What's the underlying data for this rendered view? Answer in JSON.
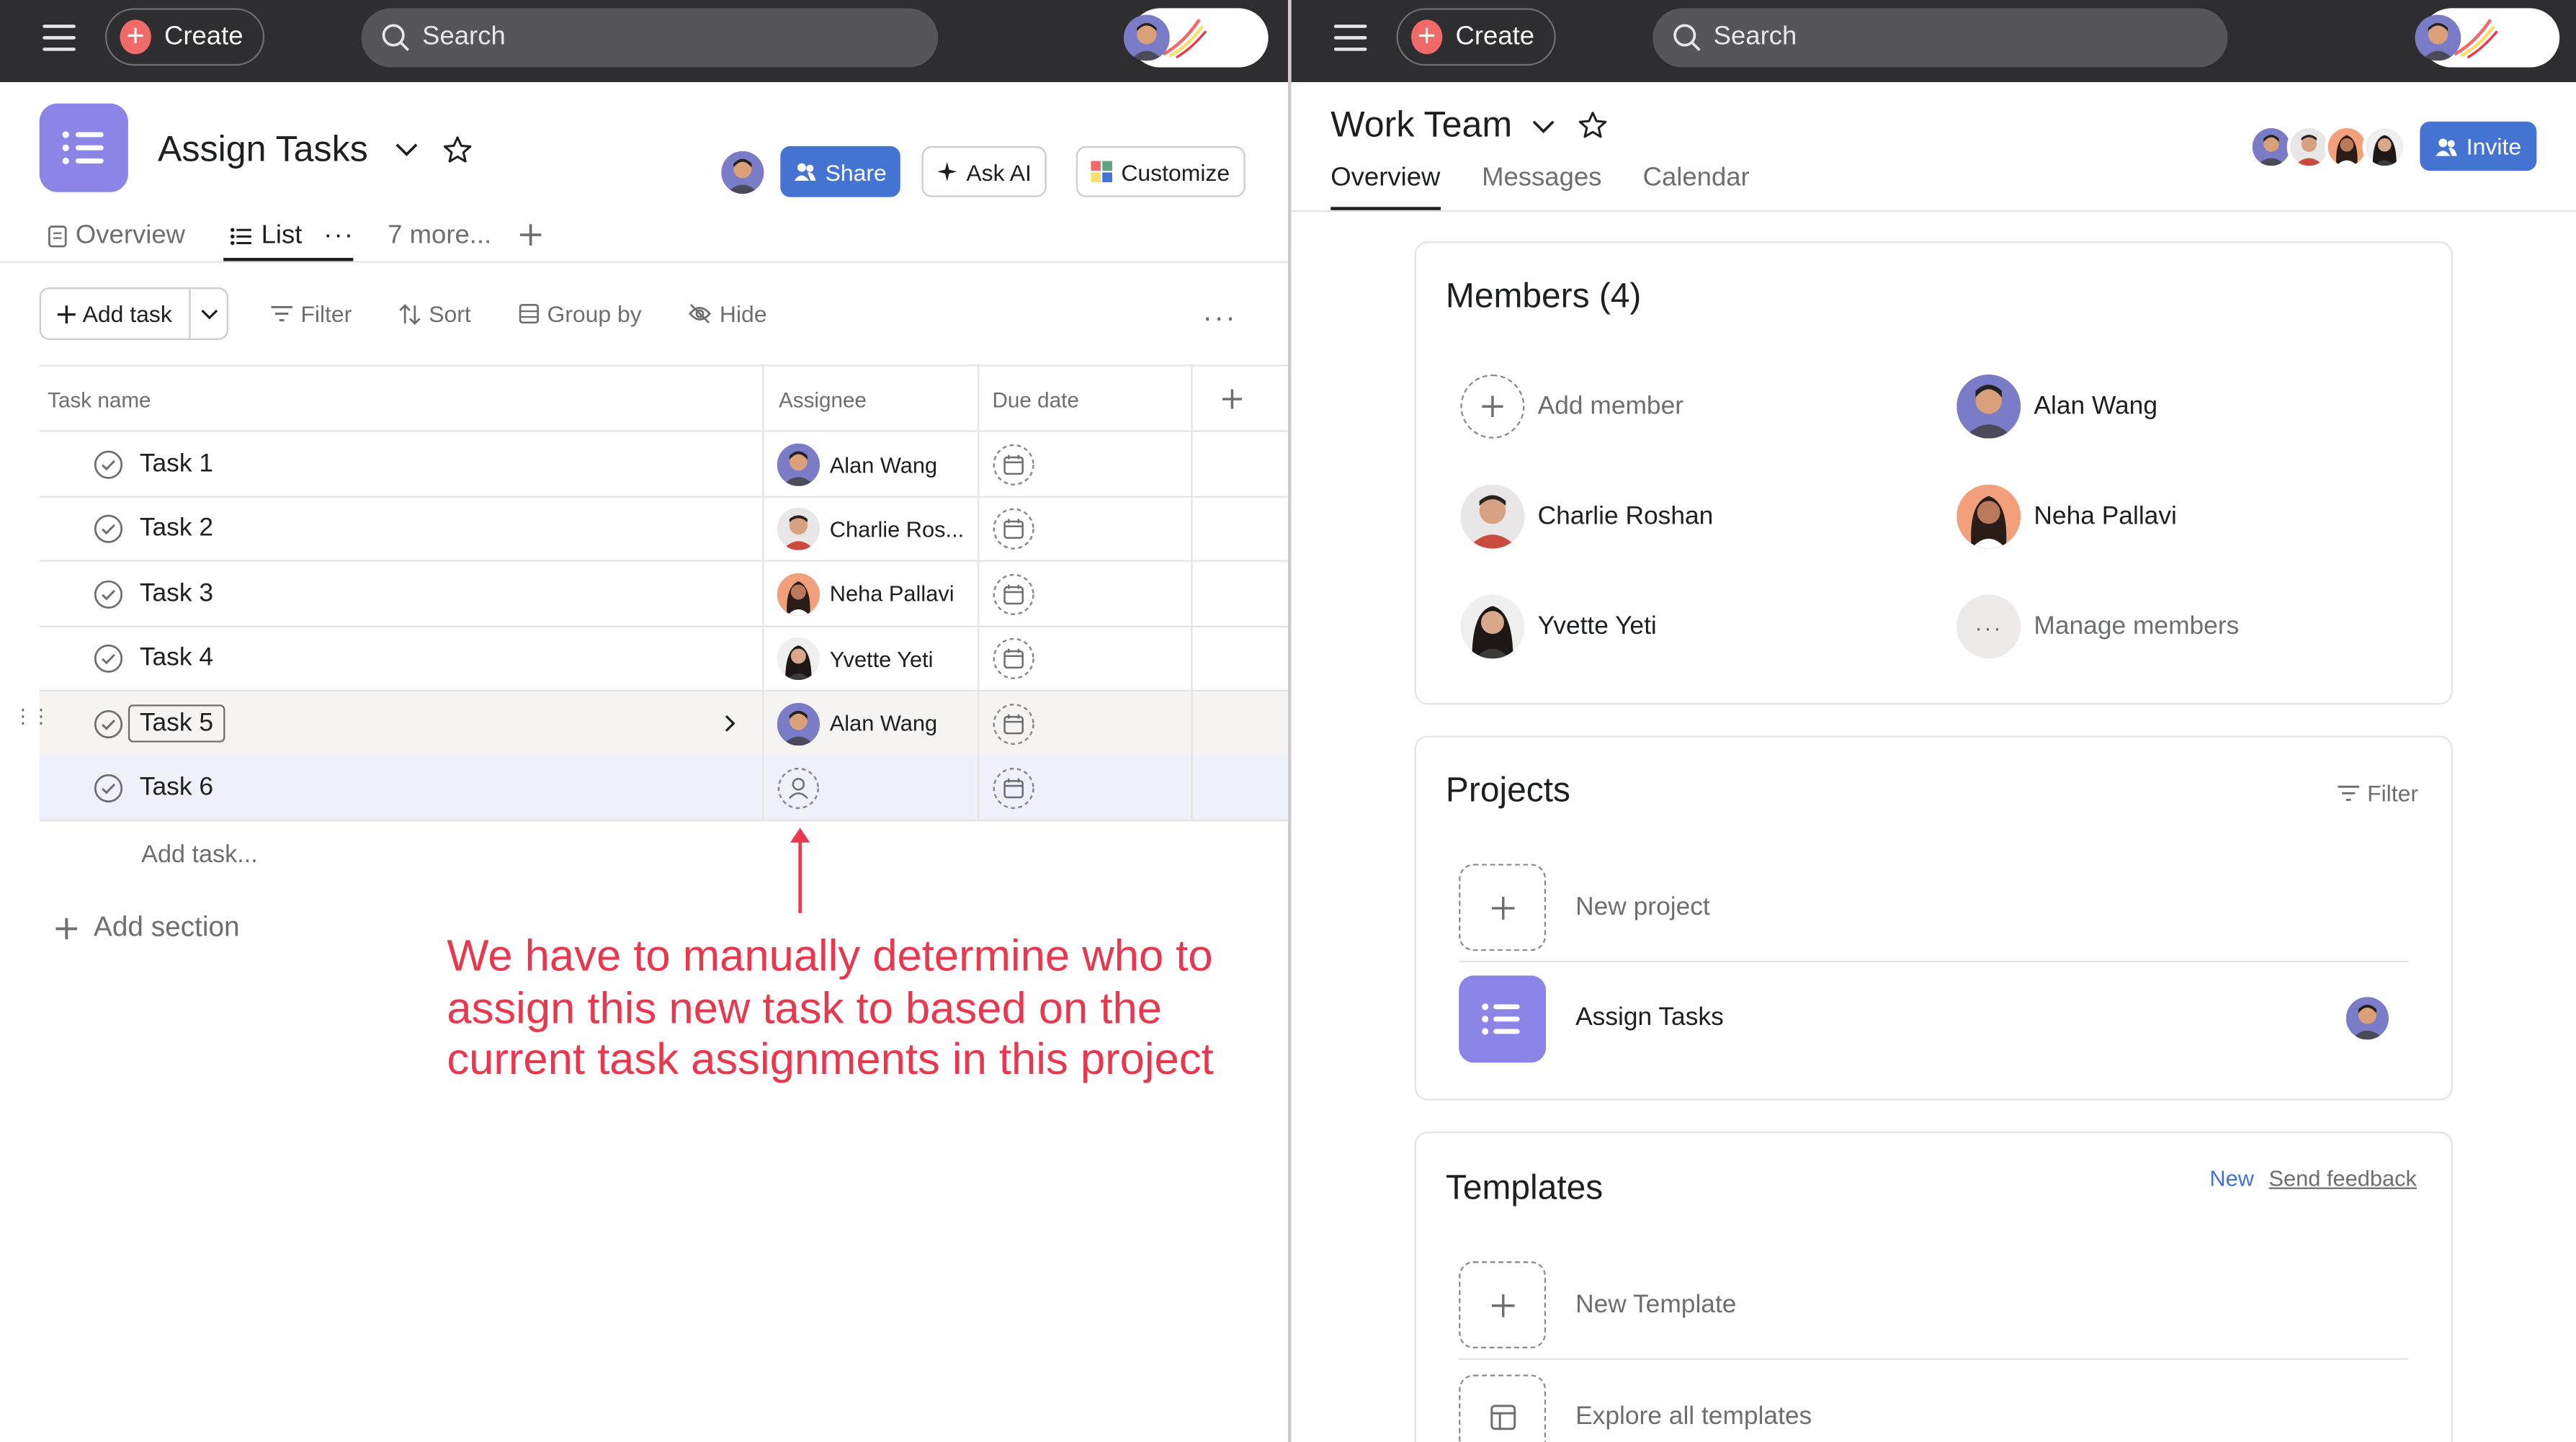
{
  "left_pane": {
    "topbar": {
      "create_label": "Create",
      "search_placeholder": "Search"
    },
    "project": {
      "title": "Assign Tasks",
      "share_label": "Share",
      "ask_ai_label": "Ask AI",
      "customize_label": "Customize",
      "tabs": [
        {
          "label": "Overview",
          "icon": "document-icon"
        },
        {
          "label": "List",
          "icon": "list-icon",
          "active": true
        },
        {
          "label": "7 more..."
        }
      ]
    },
    "toolbar": {
      "add_task_label": "Add task",
      "filter_label": "Filter",
      "sort_label": "Sort",
      "group_by_label": "Group by",
      "hide_label": "Hide"
    },
    "table": {
      "columns": [
        "Task name",
        "Assignee",
        "Due date"
      ],
      "rows": [
        {
          "task": "Task 1",
          "assignee": "Alan Wang",
          "avatar": "alan"
        },
        {
          "task": "Task 2",
          "assignee": "Charlie Ros...",
          "avatar": "charlie"
        },
        {
          "task": "Task 3",
          "assignee": "Neha Pallavi",
          "avatar": "neha"
        },
        {
          "task": "Task 4",
          "assignee": "Yvette Yeti",
          "avatar": "yvette"
        },
        {
          "task": "Task 5",
          "assignee": "Alan Wang",
          "avatar": "alan"
        },
        {
          "task": "Task 6",
          "assignee": "",
          "avatar": ""
        }
      ],
      "add_task_link": "Add task...",
      "add_section_label": "Add section"
    },
    "annotation": "We have to manually determine who to assign this new task to based on the current task assignments in this project"
  },
  "right_pane": {
    "topbar": {
      "create_label": "Create",
      "search_placeholder": "Search"
    },
    "team_title": "Work Team",
    "invite_label": "Invite",
    "tabs": [
      "Overview",
      "Messages",
      "Calendar"
    ],
    "members_card": {
      "title": "Members (4)",
      "add_member_label": "Add member",
      "manage_members_label": "Manage members",
      "members": [
        "Alan Wang",
        "Charlie Roshan",
        "Neha Pallavi",
        "Yvette Yeti"
      ]
    },
    "projects_card": {
      "title": "Projects",
      "filter_label": "Filter",
      "new_project_label": "New project",
      "project_name": "Assign Tasks"
    },
    "templates_card": {
      "title": "Templates",
      "new_badge": "New",
      "send_feedback_label": "Send feedback",
      "new_template_label": "New Template",
      "explore_label": "Explore all templates"
    }
  },
  "colors": {
    "topbar": "#2e2e30",
    "brand_coral": "#f06a6a",
    "primary_blue": "#4573d2",
    "project_purple": "#8d84e8",
    "annotation_red": "#e8384f"
  }
}
